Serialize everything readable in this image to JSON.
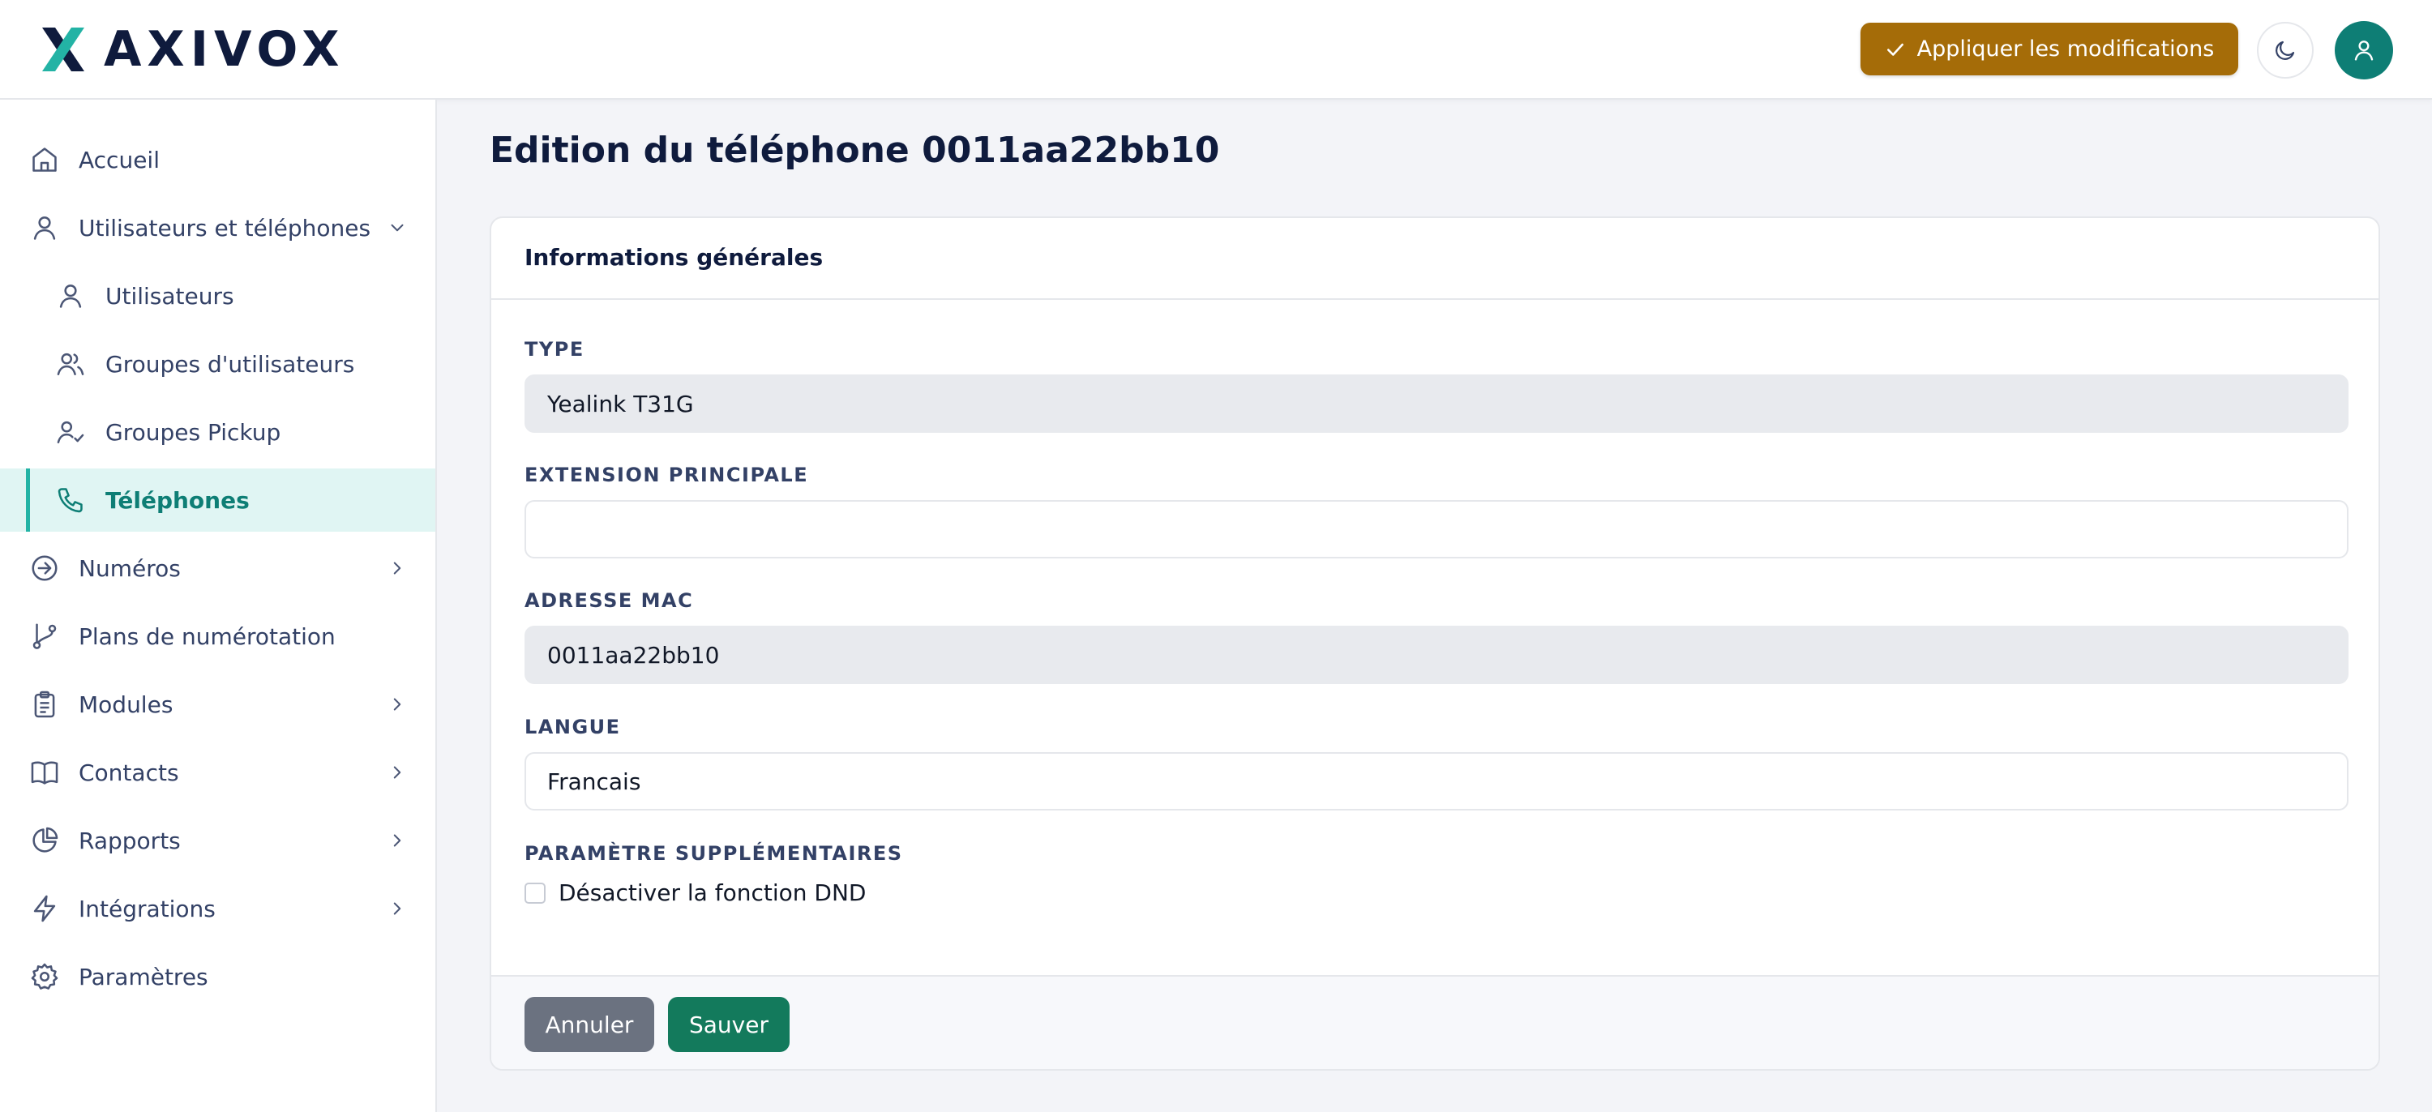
{
  "header": {
    "logo_text": "AXIVOX",
    "apply_label": "Appliquer les modifications",
    "colors": {
      "brand_teal": "#23b3a5",
      "brand_navy": "#0f1b3d",
      "apply_gold": "#a56c08",
      "avatar": "#0e7e75"
    }
  },
  "sidebar": {
    "items": [
      {
        "label": "Accueil",
        "icon": "home-icon"
      },
      {
        "label": "Utilisateurs et téléphones",
        "icon": "user-icon",
        "expanded": true
      },
      {
        "label": "Utilisateurs",
        "icon": "user-icon"
      },
      {
        "label": "Groupes d'utilisateurs",
        "icon": "users-icon"
      },
      {
        "label": "Groupes Pickup",
        "icon": "user-check-icon"
      },
      {
        "label": "Téléphones",
        "icon": "phone-icon",
        "active": true
      },
      {
        "label": "Numéros",
        "icon": "arrow-circle-icon"
      },
      {
        "label": "Plans de numérotation",
        "icon": "git-branch-icon"
      },
      {
        "label": "Modules",
        "icon": "clipboard-icon"
      },
      {
        "label": "Contacts",
        "icon": "book-icon"
      },
      {
        "label": "Rapports",
        "icon": "pie-chart-icon"
      },
      {
        "label": "Intégrations",
        "icon": "bolt-icon"
      },
      {
        "label": "Paramètres",
        "icon": "gear-icon"
      }
    ]
  },
  "main": {
    "title": "Edition du téléphone 0011aa22bb10",
    "card_title": "Informations générales",
    "fields": {
      "type": {
        "label": "TYPE",
        "value": "Yealink T31G"
      },
      "extension": {
        "label": "EXTENSION PRINCIPALE",
        "value": ""
      },
      "mac": {
        "label": "ADRESSE MAC",
        "value": "0011aa22bb10"
      },
      "langue": {
        "label": "LANGUE",
        "value": "Francais"
      }
    },
    "extra": {
      "label": "PARAMÈTRE SUPPLÉMENTAIRES",
      "dnd_label": "Désactiver la fonction DND",
      "dnd_checked": false
    },
    "buttons": {
      "cancel": "Annuler",
      "save": "Sauver"
    }
  }
}
